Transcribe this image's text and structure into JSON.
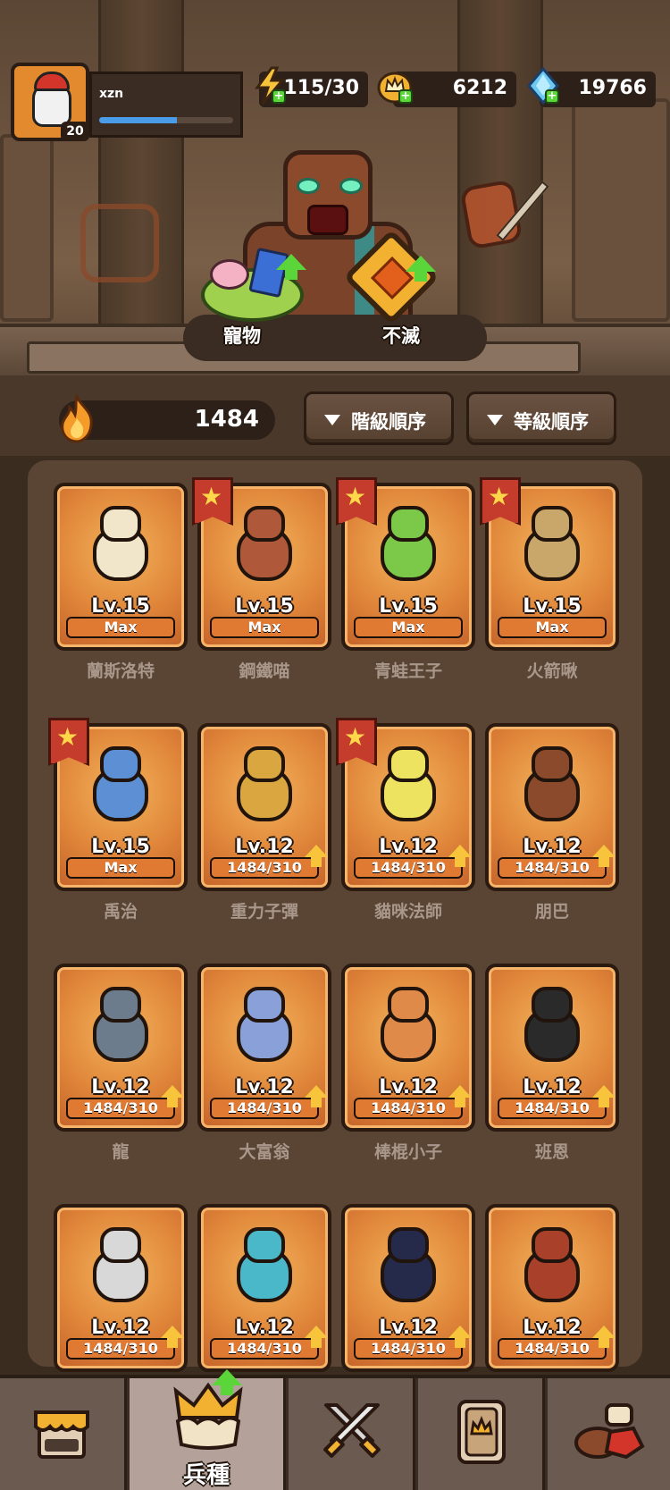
{
  "header": {
    "player_name": "xzn",
    "player_level": "20",
    "xp_fraction": 0.58,
    "energy": "115/30",
    "gold": "6212",
    "gems": "19766"
  },
  "scene": {
    "pet_label": "寵物",
    "immortal_label": "不滅"
  },
  "toolbar": {
    "power": "1484",
    "sort_rank_label": "階級順序",
    "sort_level_label": "等級順序"
  },
  "units": [
    {
      "name": "蘭斯洛特",
      "level": "Lv.15",
      "progress_text": "Max",
      "progress_fraction": 1.0,
      "starred": false,
      "upgrade": false,
      "color": "#f1e6c9"
    },
    {
      "name": "鋼鐵喵",
      "level": "Lv.15",
      "progress_text": "Max",
      "progress_fraction": 1.0,
      "starred": true,
      "upgrade": false,
      "color": "#b0593a"
    },
    {
      "name": "青蛙王子",
      "level": "Lv.15",
      "progress_text": "Max",
      "progress_fraction": 1.0,
      "starred": true,
      "upgrade": false,
      "color": "#7cc94a"
    },
    {
      "name": "火箭啾",
      "level": "Lv.15",
      "progress_text": "Max",
      "progress_fraction": 1.0,
      "starred": true,
      "upgrade": false,
      "color": "#c9a76a"
    },
    {
      "name": "禹治",
      "level": "Lv.15",
      "progress_text": "Max",
      "progress_fraction": 1.0,
      "starred": true,
      "upgrade": false,
      "color": "#5c8fd4"
    },
    {
      "name": "重力子彈",
      "level": "Lv.12",
      "progress_text": "1484/310",
      "progress_fraction": 1.0,
      "starred": false,
      "upgrade": true,
      "color": "#d9a640"
    },
    {
      "name": "貓咪法師",
      "level": "Lv.12",
      "progress_text": "1484/310",
      "progress_fraction": 1.0,
      "starred": true,
      "upgrade": true,
      "color": "#eee361"
    },
    {
      "name": "朋巴",
      "level": "Lv.12",
      "progress_text": "1484/310",
      "progress_fraction": 1.0,
      "starred": false,
      "upgrade": true,
      "color": "#8a4a2b"
    },
    {
      "name": "龍",
      "level": "Lv.12",
      "progress_text": "1484/310",
      "progress_fraction": 1.0,
      "starred": false,
      "upgrade": true,
      "color": "#6d7c8d"
    },
    {
      "name": "大富翁",
      "level": "Lv.12",
      "progress_text": "1484/310",
      "progress_fraction": 1.0,
      "starred": false,
      "upgrade": true,
      "color": "#8aa0d8"
    },
    {
      "name": "棒棍小子",
      "level": "Lv.12",
      "progress_text": "1484/310",
      "progress_fraction": 1.0,
      "starred": false,
      "upgrade": true,
      "color": "#e08a4a"
    },
    {
      "name": "班恩",
      "level": "Lv.12",
      "progress_text": "1484/310",
      "progress_fraction": 1.0,
      "starred": false,
      "upgrade": true,
      "color": "#2a2a2a"
    },
    {
      "name": "",
      "level": "Lv.12",
      "progress_text": "1484/310",
      "progress_fraction": 1.0,
      "starred": false,
      "upgrade": true,
      "color": "#d8d8d8"
    },
    {
      "name": "",
      "level": "Lv.12",
      "progress_text": "1484/310",
      "progress_fraction": 1.0,
      "starred": false,
      "upgrade": true,
      "color": "#4ab8c9"
    },
    {
      "name": "",
      "level": "Lv.12",
      "progress_text": "1484/310",
      "progress_fraction": 1.0,
      "starred": false,
      "upgrade": true,
      "color": "#262a4a"
    },
    {
      "name": "",
      "level": "Lv.12",
      "progress_text": "1484/310",
      "progress_fraction": 1.0,
      "starred": false,
      "upgrade": true,
      "color": "#a8402a"
    }
  ],
  "nav": {
    "shop_icon": "shop-icon",
    "troops_label": "兵種",
    "battle_icon": "crossed-swords-icon",
    "card_icon": "card-icon",
    "misc_icon": "food-icon"
  }
}
